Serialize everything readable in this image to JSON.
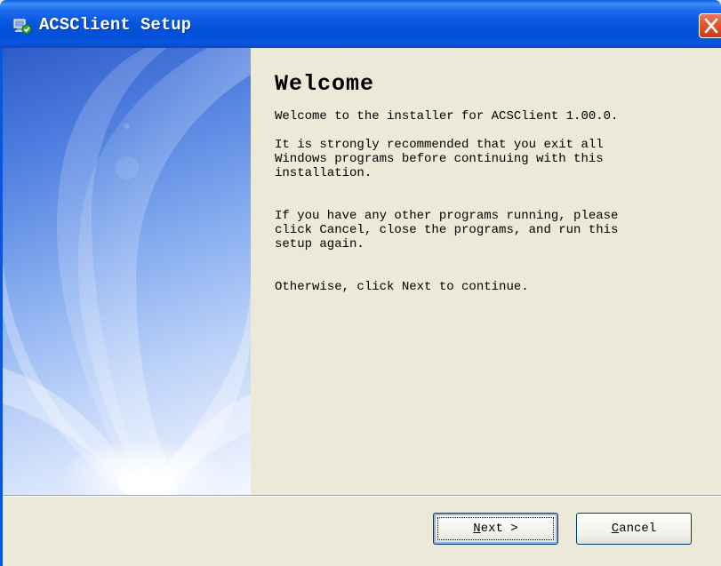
{
  "window": {
    "title": "ACSClient Setup",
    "icon": "installer-icon",
    "close_icon": "close-icon"
  },
  "content": {
    "heading": "Welcome",
    "paragraphs": [
      "Welcome to the installer for ACSClient 1.00.0.",
      "It is strongly recommended that you exit all\nWindows programs before continuing with this\ninstallation.",
      "If you have any other programs running, please\nclick Cancel, close the programs, and run this\nsetup again.",
      "Otherwise, click Next to continue."
    ]
  },
  "buttons": {
    "next": {
      "mnemonic": "N",
      "rest": "ext >"
    },
    "cancel": {
      "mnemonic": "C",
      "rest": "ancel"
    }
  },
  "colors": {
    "titlebar": "#0757e0",
    "close_button": "#e2552f",
    "dialog_face": "#ece9d8"
  }
}
